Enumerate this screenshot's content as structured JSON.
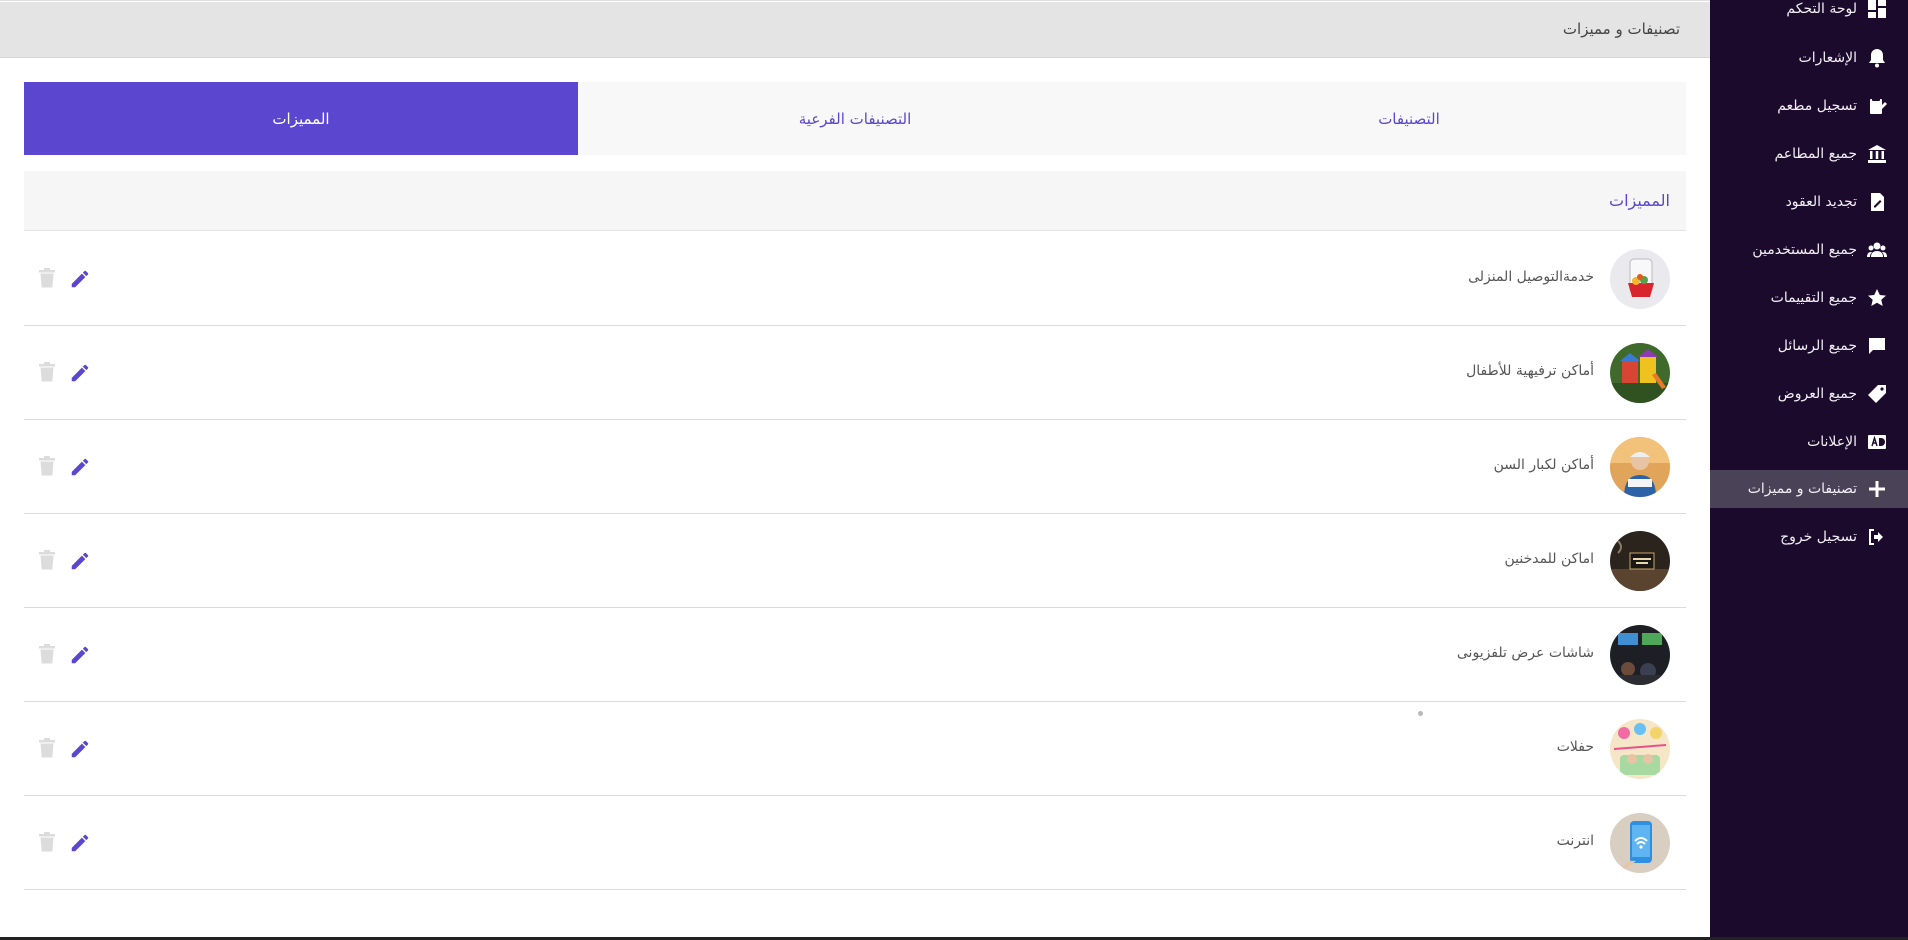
{
  "header": {
    "title": "تصنيفات و مميزات"
  },
  "tabs": [
    {
      "label": "التصنيفات"
    },
    {
      "label": "التصنيفات الفرعية"
    },
    {
      "label": "المميزات"
    }
  ],
  "active_tab": "المميزات",
  "section": {
    "title": "المميزات"
  },
  "features": [
    {
      "name": "خدمةالتوصيل المنزلى",
      "icon": "delivery-image"
    },
    {
      "name": "أماكن ترفيهية للأطفال",
      "icon": "playground-image"
    },
    {
      "name": "أماكن لكبار السن",
      "icon": "elderly-image"
    },
    {
      "name": "اماكن للمدخنين",
      "icon": "smoking-area-image"
    },
    {
      "name": "شاشات عرض تلفزيونى",
      "icon": "tv-screens-image"
    },
    {
      "name": "حفلات",
      "icon": "party-image"
    },
    {
      "name": "انترنت",
      "icon": "wifi-image"
    }
  ],
  "sidebar": {
    "items": [
      {
        "label": "لوحة التحكم",
        "icon": "dashboard-icon"
      },
      {
        "label": "الإشعارات",
        "icon": "bell-icon"
      },
      {
        "label": "تسجيل مطعم",
        "icon": "register-restaurant-icon"
      },
      {
        "label": "جميع المطاعم",
        "icon": "bank-icon"
      },
      {
        "label": "تجديد العقود",
        "icon": "contract-icon"
      },
      {
        "label": "جميع المستخدمين",
        "icon": "users-icon"
      },
      {
        "label": "جميع التقييمات",
        "icon": "star-icon"
      },
      {
        "label": "جميع الرسائل",
        "icon": "message-icon"
      },
      {
        "label": "جميع العروض",
        "icon": "offer-tag-icon"
      },
      {
        "label": "الإعلانات",
        "icon": "ads-icon"
      },
      {
        "label": "تصنيفات و مميزات",
        "icon": "plus-icon",
        "active": true
      },
      {
        "label": "تسجيل خروج",
        "icon": "logout-icon"
      }
    ]
  },
  "colors": {
    "accent": "#5b47cf",
    "sidebar_bg": "#1c0a2c",
    "active_item_bg": "#4a4256",
    "topbar_bg": "#e4e4e4"
  }
}
